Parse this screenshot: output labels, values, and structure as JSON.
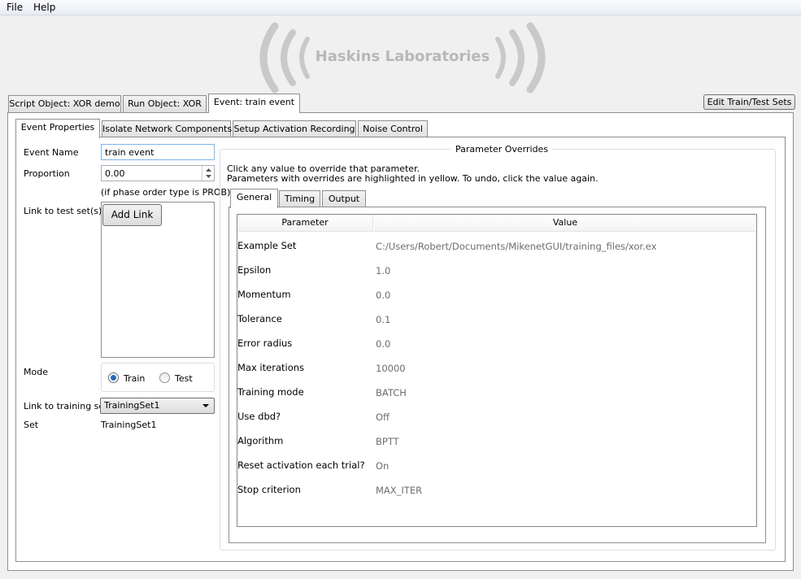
{
  "menubar": {
    "file": "File",
    "help": "Help"
  },
  "logo": {
    "text": "Haskins Laboratories"
  },
  "top_tabs": [
    "Script Object: XOR demo",
    "Run Object: XOR",
    "Event: train event"
  ],
  "edit_sets_button": "Edit Train/Test Sets",
  "inner_tabs": [
    "Event Properties",
    "Isolate Network Components",
    "Setup Activation Recording",
    "Noise Control"
  ],
  "event": {
    "name_label": "Event Name",
    "name_value": "train event",
    "proportion_label": "Proportion",
    "proportion_value": "0.00",
    "proportion_hint": "(if phase order type is PROB)",
    "link_test_label": "Link to test set(s)",
    "add_link_button": "Add Link",
    "mode_label": "Mode",
    "mode_train": "Train",
    "mode_test": "Test",
    "mode_selected": "Train",
    "link_training_label": "Link to training set",
    "training_set_selected": "TrainingSet1",
    "set_label": "Set",
    "set_value": "TrainingSet1"
  },
  "overrides": {
    "title": "Parameter Overrides",
    "instruction_1": "Click any value to override that parameter.",
    "instruction_2": "Parameters with overrides are highlighted in yellow. To undo, click the value again.",
    "tabs": [
      "General",
      "Timing",
      "Output"
    ],
    "col_parameter": "Parameter",
    "col_value": "Value",
    "rows": [
      {
        "param": "Example Set",
        "value": "C:/Users/Robert/Documents/MikenetGUI/training_files/xor.ex"
      },
      {
        "param": "Epsilon",
        "value": "1.0"
      },
      {
        "param": "Momentum",
        "value": "0.0"
      },
      {
        "param": "Tolerance",
        "value": "0.1"
      },
      {
        "param": "Error radius",
        "value": "0.0"
      },
      {
        "param": "Max iterations",
        "value": "10000"
      },
      {
        "param": "Training mode",
        "value": "BATCH"
      },
      {
        "param": "Use dbd?",
        "value": "Off"
      },
      {
        "param": "Algorithm",
        "value": "BPTT"
      },
      {
        "param": "Reset activation each trial?",
        "value": "On"
      },
      {
        "param": "Stop criterion",
        "value": "MAX_ITER"
      }
    ]
  }
}
